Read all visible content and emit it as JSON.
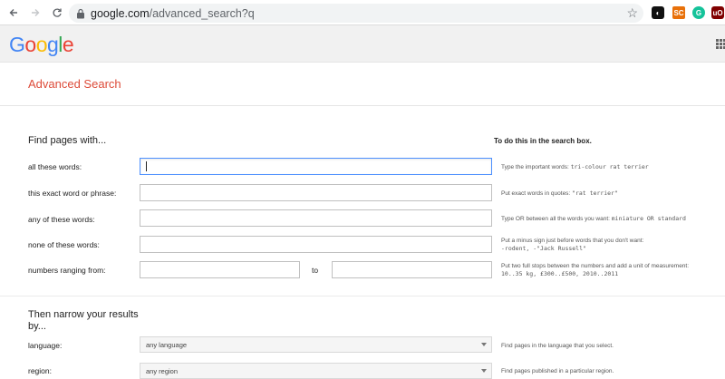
{
  "browser": {
    "back_icon": "arrow-left-icon",
    "forward_icon": "arrow-right-icon",
    "reload_icon": "reload-icon",
    "url_host": "google.com",
    "url_path": "/advanced_search?q",
    "extensions": [
      {
        "name": "ext-dark",
        "glyph": "◐"
      },
      {
        "name": "ext-orange",
        "glyph": "SC"
      },
      {
        "name": "ext-grammarly",
        "glyph": "G"
      },
      {
        "name": "ext-ublock",
        "glyph": "uO"
      }
    ]
  },
  "logo": [
    "G",
    "o",
    "o",
    "g",
    "l",
    "e"
  ],
  "page_title": "Advanced Search",
  "find_section": {
    "heading": "Find pages with...",
    "hint_heading": "To do this in the search box.",
    "rows": [
      {
        "label": "all these words:",
        "value": "",
        "hint_text": "Type the important words: ",
        "hint_code": "tri-colour rat terrier",
        "hint_line2": ""
      },
      {
        "label": "this exact word or phrase:",
        "value": "",
        "hint_text": "Put exact words in quotes: ",
        "hint_code": "\"rat terrier\"",
        "hint_line2": ""
      },
      {
        "label": "any of these words:",
        "value": "",
        "hint_text": "Type OR between all the words you want: ",
        "hint_code": "miniature OR standard",
        "hint_line2": ""
      },
      {
        "label": "none of these words:",
        "value": "",
        "hint_text": "Put a minus sign just before words that you don't want:",
        "hint_code": "",
        "hint_line2": "-rodent, -\"Jack Russell\""
      },
      {
        "label": "numbers ranging from:",
        "value": "",
        "hint_text": "Put two full stops between the numbers and add a unit of measurement:",
        "hint_code": "",
        "hint_line2": "10..35 kg, £300..£500, 2010..2011"
      }
    ],
    "range_to": "to"
  },
  "narrow_section": {
    "heading_line1": "Then narrow your results",
    "heading_line2": "by...",
    "rows": [
      {
        "label": "language:",
        "selected": "any language",
        "hint": "Find pages in the language that you select."
      },
      {
        "label": "region:",
        "selected": "any region",
        "hint": "Find pages published in a particular region."
      }
    ]
  }
}
